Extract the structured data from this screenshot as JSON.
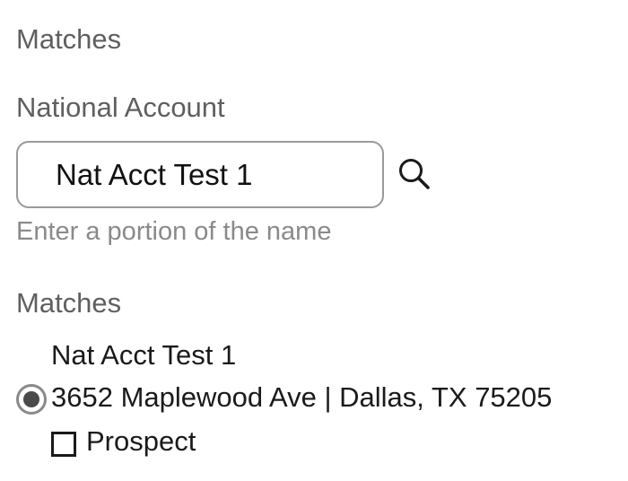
{
  "header": {
    "title": "Matches"
  },
  "search": {
    "label": "National Account",
    "value": "Nat Acct Test 1",
    "hint": "Enter a portion of the name",
    "icon": "search-icon"
  },
  "results": {
    "heading": "Matches",
    "items": [
      {
        "name": "Nat Acct Test 1",
        "address": "3652 Maplewood Ave | Dallas, TX 75205",
        "selected": true,
        "prospect_label": "Prospect",
        "prospect_checked": false
      }
    ]
  }
}
